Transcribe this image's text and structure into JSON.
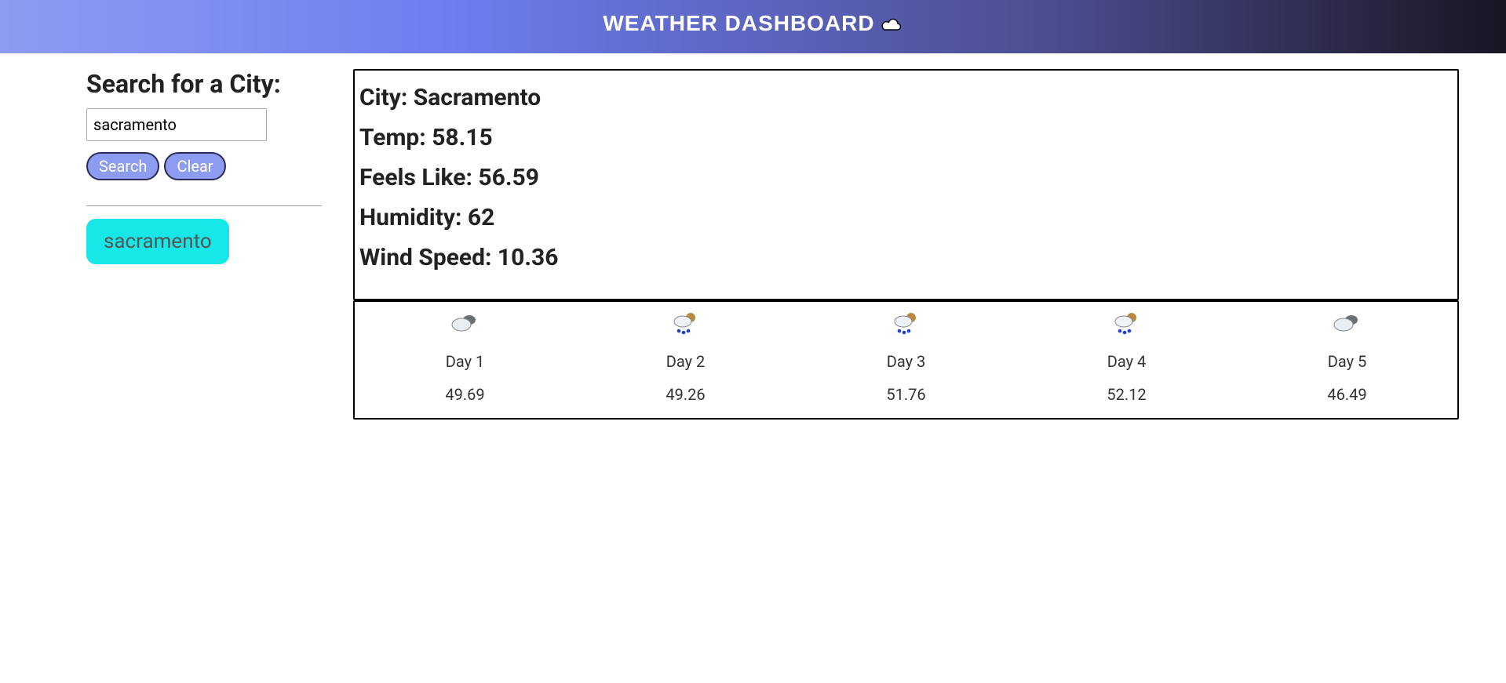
{
  "header": {
    "title": "WEATHER DASHBOARD"
  },
  "sidebar": {
    "search_title": "Search for a City:",
    "search_value": "sacramento",
    "search_placeholder": "",
    "search_button": "Search",
    "clear_button": "Clear",
    "history": [
      "sacramento"
    ]
  },
  "today": {
    "labels": {
      "city": "City: ",
      "temp": "Temp: ",
      "feels": "Feels Like: ",
      "humidity": "Humidity: ",
      "wind": "Wind Speed: "
    },
    "city": "Sacramento",
    "temp": "58.15",
    "feels_like": "56.59",
    "humidity": "62",
    "wind_speed": "10.36"
  },
  "forecast": [
    {
      "icon": "cloudy",
      "label": "Day 1",
      "temp": "49.69"
    },
    {
      "icon": "rain-sun",
      "label": "Day 2",
      "temp": "49.26"
    },
    {
      "icon": "rain-sun",
      "label": "Day 3",
      "temp": "51.76"
    },
    {
      "icon": "rain-sun",
      "label": "Day 4",
      "temp": "52.12"
    },
    {
      "icon": "cloudy",
      "label": "Day 5",
      "temp": "46.49"
    }
  ]
}
